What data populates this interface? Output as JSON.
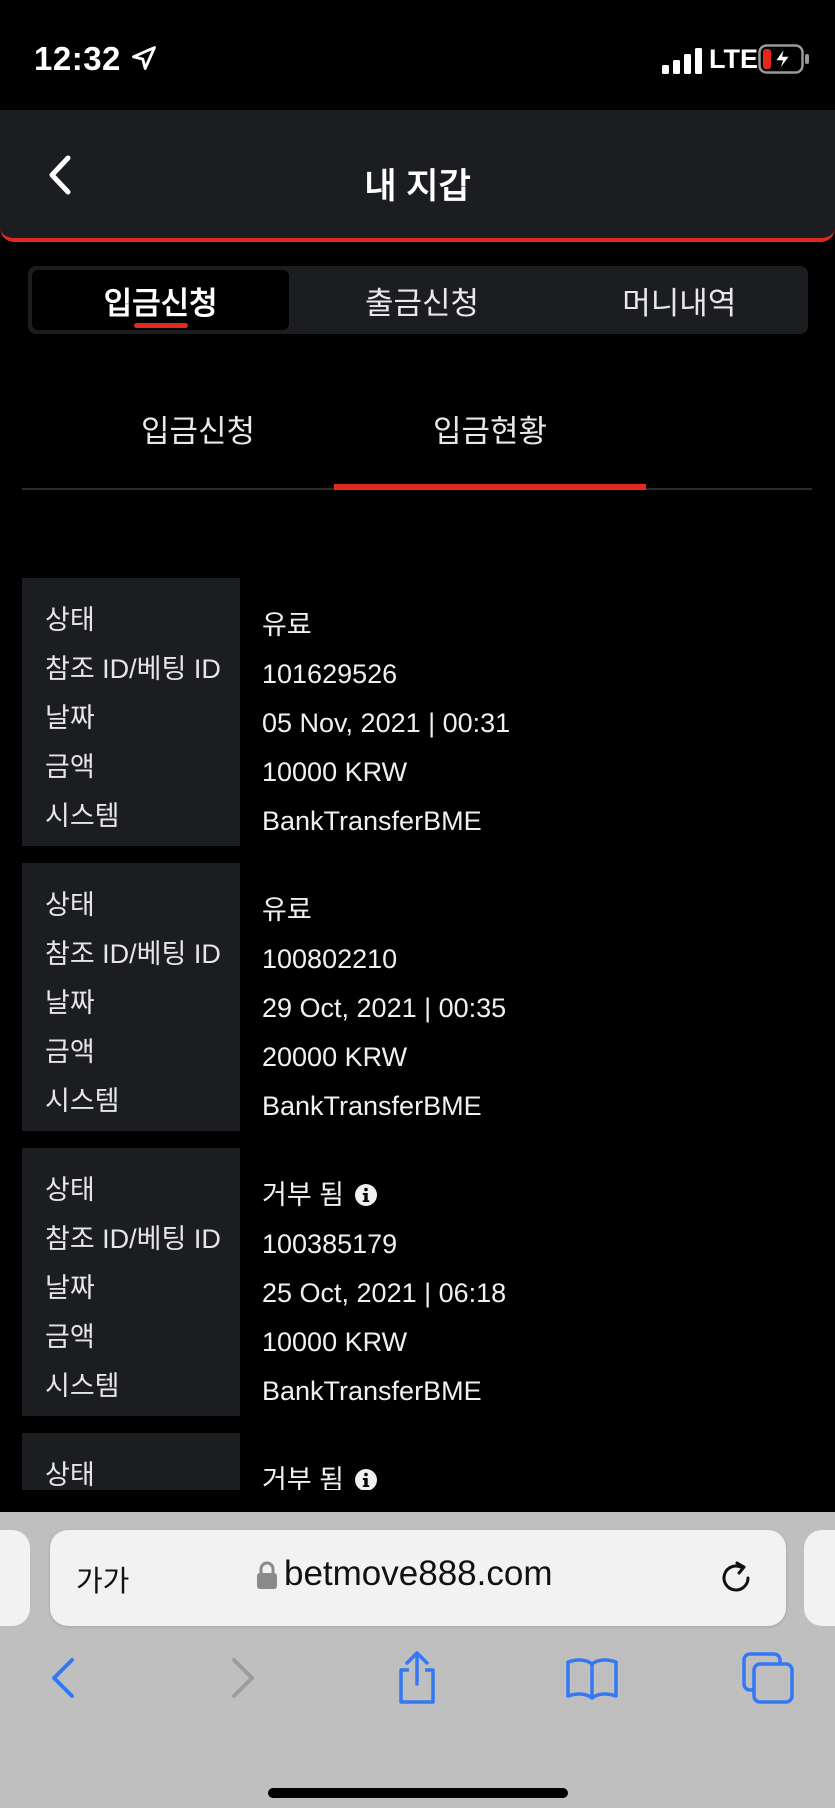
{
  "status_bar": {
    "time": "12:32",
    "network": "LTE"
  },
  "header": {
    "title": "내 지갑"
  },
  "segment_tabs": [
    {
      "label": "입금신청",
      "active": true
    },
    {
      "label": "출금신청",
      "active": false
    },
    {
      "label": "머니내역",
      "active": false
    }
  ],
  "sub_tabs": [
    {
      "label": "입금신청",
      "active": false
    },
    {
      "label": "입금현황",
      "active": true
    }
  ],
  "field_labels": {
    "status": "상태",
    "ref_id": "참조 ID/베팅 ID",
    "date": "날짜",
    "amount": "금액",
    "system": "시스템"
  },
  "records": [
    {
      "status": "유료",
      "status_info": false,
      "ref_id": "101629526",
      "date": "05 Nov, 2021 | 00:31",
      "amount": "10000 KRW",
      "system": "BankTransferBME"
    },
    {
      "status": "유료",
      "status_info": false,
      "ref_id": "100802210",
      "date": "29 Oct, 2021 | 00:35",
      "amount": "20000 KRW",
      "system": "BankTransferBME"
    },
    {
      "status": "거부 됨",
      "status_info": true,
      "ref_id": "100385179",
      "date": "25 Oct, 2021 | 06:18",
      "amount": "10000 KRW",
      "system": "BankTransferBME"
    },
    {
      "status": "거부 됨",
      "status_info": true,
      "ref_id": "",
      "date": "",
      "amount": "",
      "system": ""
    }
  ],
  "browser": {
    "text_size_label": "가가",
    "url": "betmove888.com"
  },
  "colors": {
    "accent": "#e5281e",
    "panel": "#1c1d21",
    "background": "#000000",
    "browser_blue": "#3478f6"
  }
}
